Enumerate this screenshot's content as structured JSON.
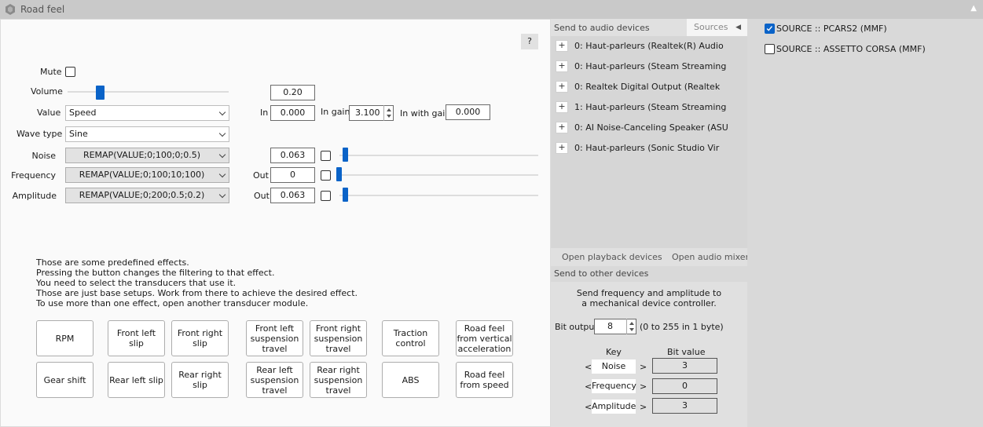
{
  "window": {
    "title": "Road feel",
    "collapse_icon": "triangle-up-icon"
  },
  "help_button": "?",
  "mute": {
    "label": "Mute",
    "checked": false
  },
  "volume": {
    "label": "Volume",
    "value": "0.20",
    "level": 0.2
  },
  "value_row": {
    "label": "Value",
    "selected": "Speed",
    "in_label": "In",
    "in_value": "0.000",
    "gain_label": "In gain",
    "gain_value": "3.100",
    "with_gain_label": "In with gain",
    "with_gain_value": "0.000"
  },
  "wave_type": {
    "label": "Wave type",
    "selected": "Sine"
  },
  "noise": {
    "label": "Noise",
    "formula": "REMAP(VALUE;0;100;0;0.5)",
    "value": "0.063",
    "checked": false,
    "level": 0.063
  },
  "frequency": {
    "label": "Frequency",
    "formula": "REMAP(VALUE;0;100;10;100)",
    "out_label": "Out",
    "value": "0",
    "checked": false,
    "level": 0
  },
  "amplitude": {
    "label": "Amplitude",
    "formula": "REMAP(VALUE;0;200;0.5;0.2)",
    "out_label": "Out",
    "value": "0.063",
    "checked": false,
    "level": 0.063
  },
  "description": [
    "Those are some predefined effects.",
    "Pressing the button changes the filtering to that effect.",
    "You need to select the transducers that use it.",
    "Those are just base setups. Work from there to achieve the desired effect.",
    "To use more than one effect, open another transducer module."
  ],
  "effects": {
    "row1": [
      "RPM",
      "Front left slip",
      "Front right\nslip",
      "Front left\nsuspension\ntravel",
      "Front right\nsuspension\ntravel",
      "Traction\ncontrol",
      "Road feel\nfrom vertical\nacceleration"
    ],
    "row2": [
      "Gear shift",
      "Rear left slip",
      "Rear right\nslip",
      "Rear left\nsuspension\ntravel",
      "Rear right\nsuspension\ntravel",
      "ABS",
      "Road feel\nfrom speed"
    ]
  },
  "audio": {
    "header": "Send to audio devices",
    "sources_tab": "Sources",
    "expand_label": "+",
    "devices": [
      "0: Haut-parleurs (Realtek(R) Audio",
      "0: Haut-parleurs (Steam Streaming",
      "0: Realtek Digital Output (Realtek",
      "1: Haut-parleurs (Steam Streaming",
      "0: AI Noise-Canceling Speaker (ASU",
      "0: Haut-parleurs (Sonic Studio Vir"
    ],
    "open_playback": "Open playback devices",
    "open_mixer": "Open audio mixer"
  },
  "other_devices": {
    "header": "Send to other devices",
    "info_line1": "Send frequency and amplitude to",
    "info_line2": "a mechanical device controller.",
    "bit_output_label": "Bit output",
    "bit_output_value": "8",
    "bit_range": "(0 to 255 in 1 byte)",
    "key_header": "Key",
    "bit_value_header": "Bit value",
    "rows": [
      {
        "key": "Noise",
        "value": "3"
      },
      {
        "key": "Frequency",
        "value": "0"
      },
      {
        "key": "Amplitude",
        "value": "3"
      }
    ],
    "left_arrow": "<",
    "right_arrow": ">"
  },
  "sources": [
    {
      "label": "SOURCE :: PCARS2 (MMF)",
      "checked": true
    },
    {
      "label": "SOURCE :: ASSETTO CORSA (MMF)",
      "checked": false
    }
  ]
}
